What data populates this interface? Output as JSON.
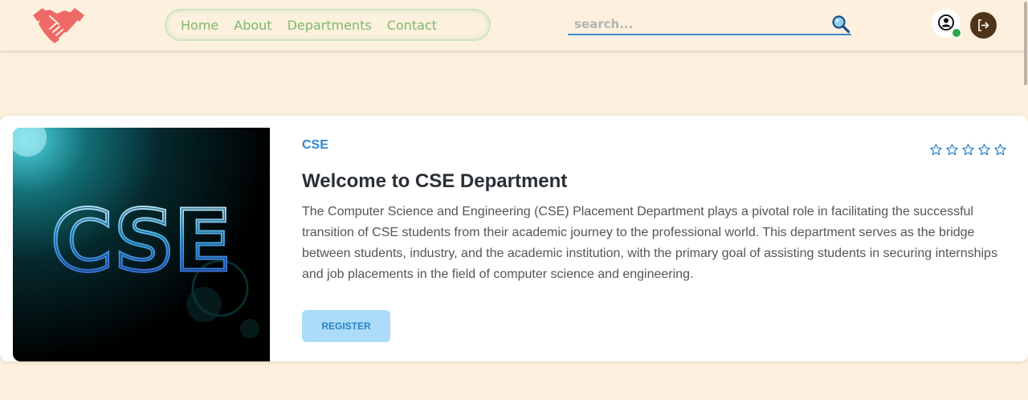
{
  "nav": {
    "links": [
      "Home",
      "About",
      "Departments",
      "Contact"
    ],
    "search_placeholder": "search..."
  },
  "card": {
    "tag": "CSE",
    "title": "Welcome to CSE Department",
    "description": "The Computer Science and Engineering (CSE) Placement Department plays a pivotal role in facilitating the successful transition of CSE students from their academic journey to the professional world. This department serves as the bridge between students, industry, and the academic institution, with the primary goal of assisting students in securing internships and job placements in the field of computer science and engineering.",
    "register_label": "REGISTER",
    "rating": 0,
    "rating_max": 5,
    "image_text": "CSE"
  },
  "colors": {
    "page_bg": "#fdf0de",
    "nav_link": "#7fb86e",
    "accent_blue": "#2f87cf",
    "logo_red": "#ee6a66",
    "logout_bg": "#4e3418",
    "online": "#2fa84a"
  },
  "icons": {
    "logo": "handshake-icon",
    "search": "magnifier-icon",
    "profile": "user-circle-icon",
    "logout": "logout-icon",
    "rating": "star-outline-icon"
  }
}
